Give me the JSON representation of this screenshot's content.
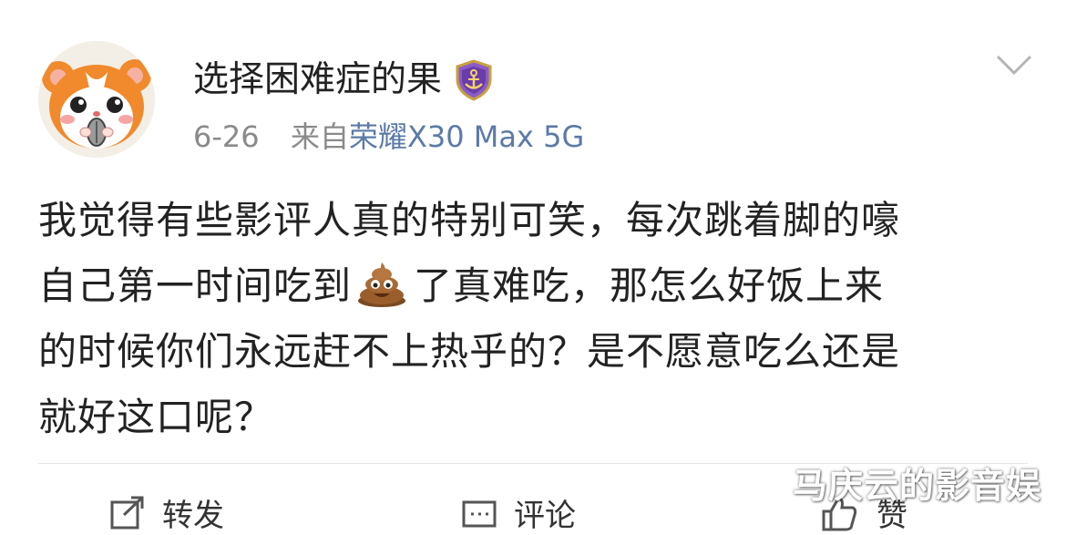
{
  "user": {
    "name": "选择困难症的果",
    "badge_icon": "shield-anchor-badge-icon"
  },
  "meta": {
    "date": "6-26",
    "from_label": "来自",
    "device": "荣耀X30 Max 5G"
  },
  "post": {
    "lines": [
      "我觉得有些影评人真的特别可笑，每次跳着脚的嚎",
      "自己第一时间吃到",
      "了真难吃，那怎么好饭上来",
      "的时候你们永远赶不上热乎的？是不愿意吃么还是",
      "就好这口呢？"
    ],
    "emoji": "pile-of-poo-icon"
  },
  "actions": {
    "repost_label": "转发",
    "comment_label": "评论",
    "like_label": "赞"
  },
  "watermark": "马庆云的影音娱",
  "colors": {
    "text": "#222222",
    "meta": "#8a8a8a",
    "device": "#5b7aa8",
    "avatar_orange": "#f08a2c"
  }
}
